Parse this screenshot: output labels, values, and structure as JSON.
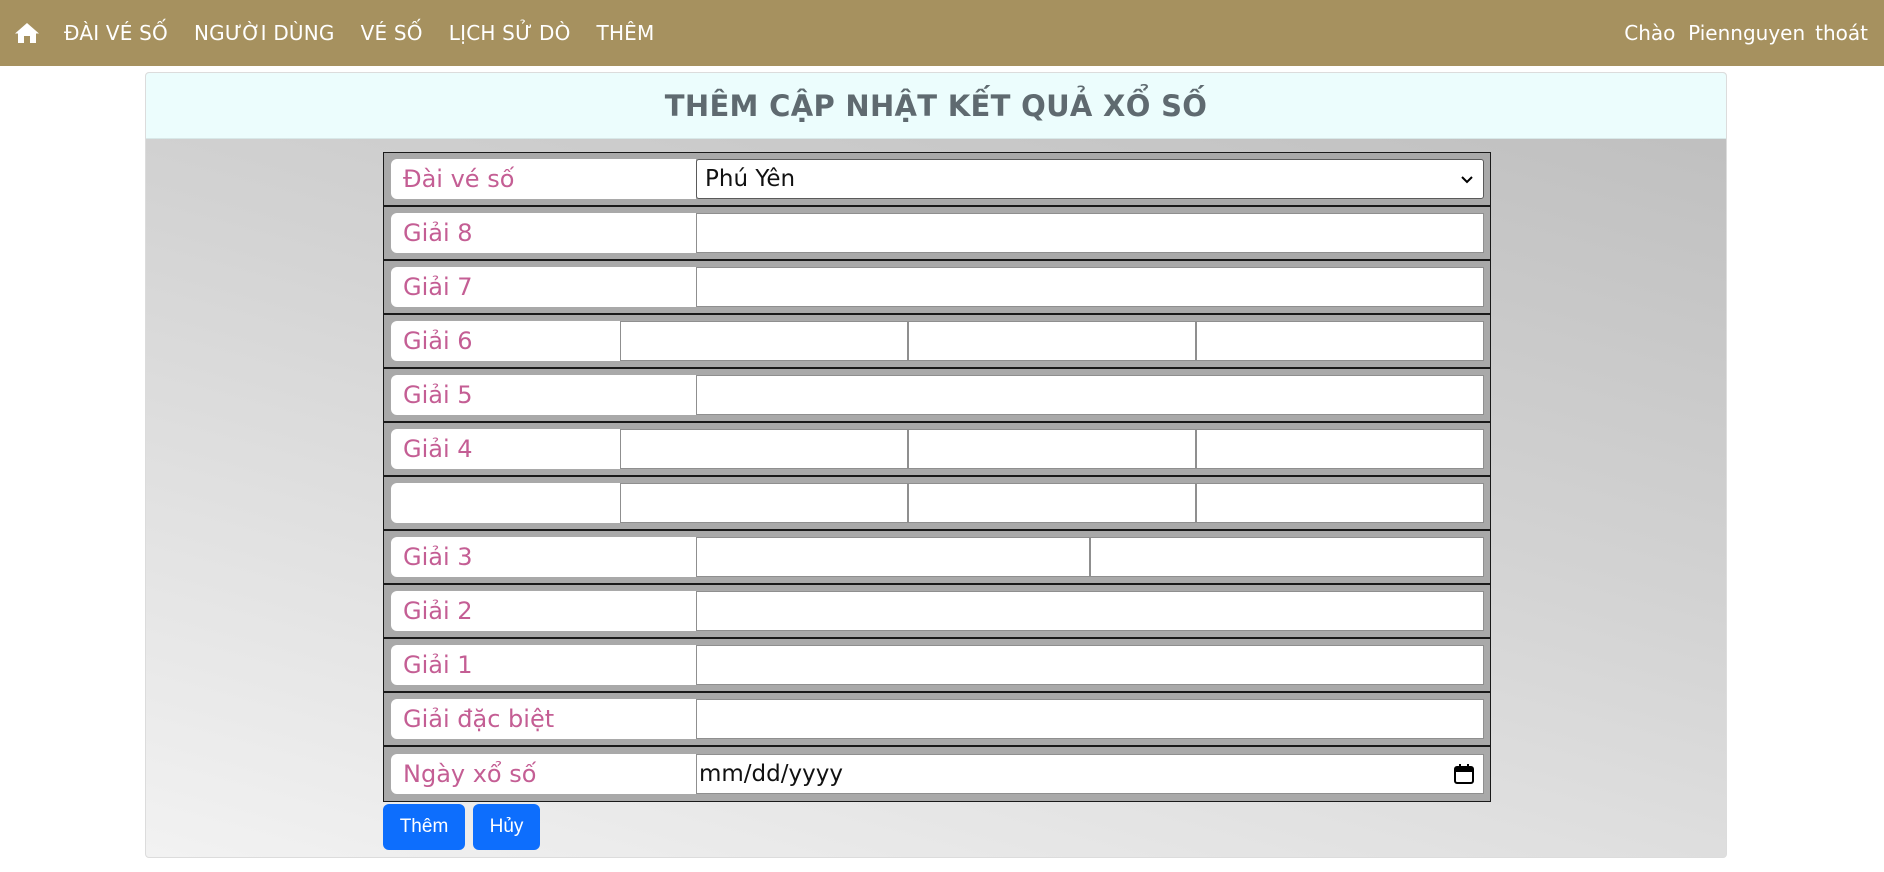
{
  "nav": {
    "home_icon": "home-icon",
    "items": [
      "ĐÀI VÉ SỐ",
      "NGƯỜI DÙNG",
      "VÉ SỐ",
      "LỊCH SỬ DÒ",
      "THÊM"
    ],
    "greeting": "Chào  Piennguyen",
    "logout": "thoát",
    "bar_color": "#a6915f"
  },
  "panel": {
    "title": "THÊM CẬP NHẬT KẾT QUẢ XỔ SỐ"
  },
  "form": {
    "station_label": "Đài vé số",
    "station_value": "Phú Yên",
    "prize8_label": "Giải 8",
    "prize7_label": "Giải 7",
    "prize6_label": "Giải 6",
    "prize5_label": "Giải 5",
    "prize4_label": "Giải 4",
    "prize4b_label": "",
    "prize3_label": "Giải 3",
    "prize2_label": "Giải 2",
    "prize1_label": "Giải 1",
    "special_label": "Giải đặc biệt",
    "date_label": "Ngày xổ số",
    "date_placeholder": "mm/dd/yyyy"
  },
  "buttons": {
    "add": "Thêm",
    "cancel": "Hủy",
    "color": "#0d6efd"
  },
  "colors": {
    "label_text": "#c45e94",
    "title_text": "#5f6a70",
    "header_bg": "#ecfdfd"
  }
}
